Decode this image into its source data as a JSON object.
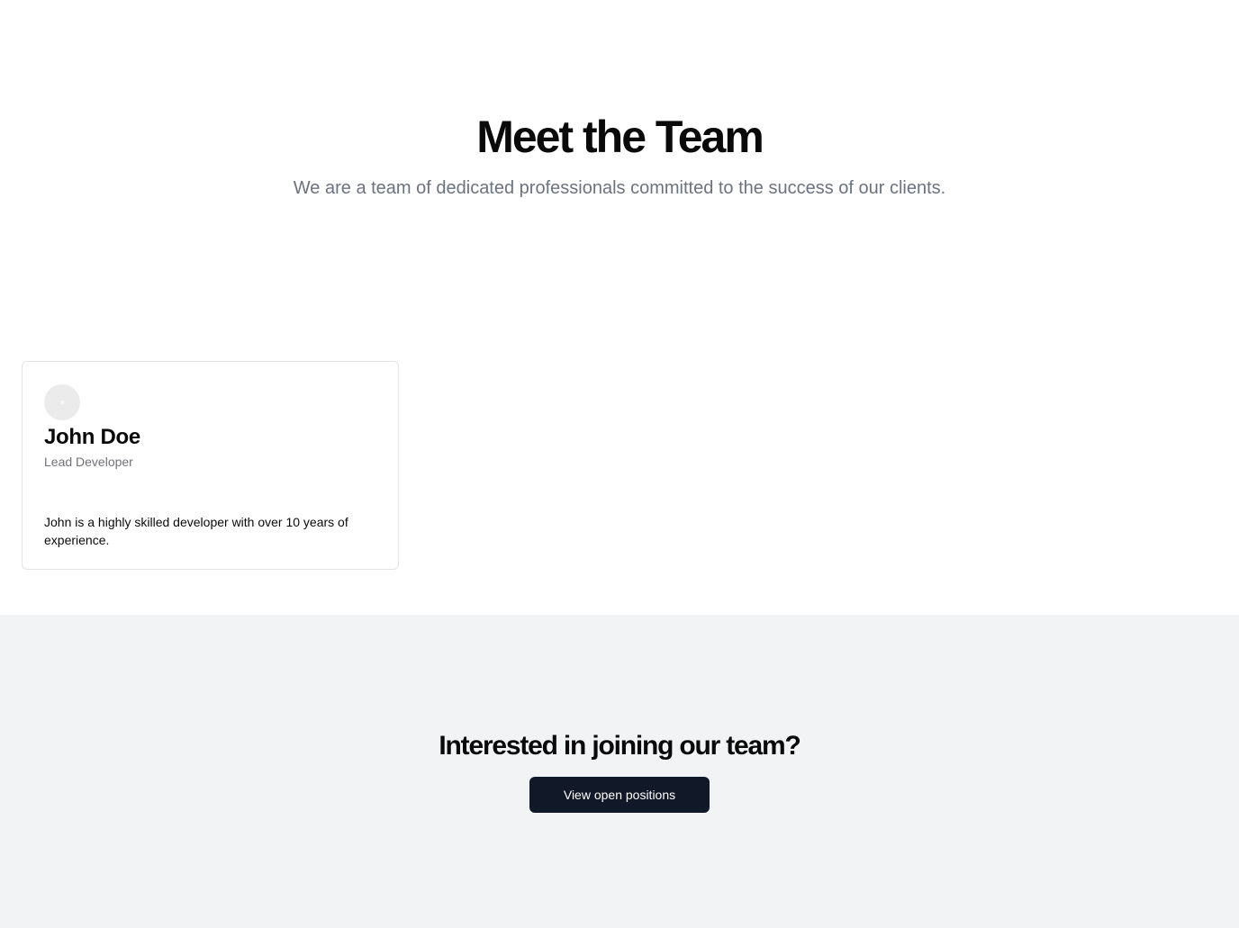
{
  "hero": {
    "title": "Meet the Team",
    "subtitle": "We are a team of dedicated professionals committed to the success of our clients."
  },
  "team": {
    "members": [
      {
        "name": "John Doe",
        "role": "Lead Developer",
        "bio": "John is a highly skilled developer with over 10 years of experience."
      }
    ]
  },
  "cta": {
    "title": "Interested in joining our team?",
    "button_label": "View open positions"
  },
  "colors": {
    "cta_background": "#f2f3f5",
    "button_background": "#111827",
    "muted_text": "#6b7280"
  }
}
